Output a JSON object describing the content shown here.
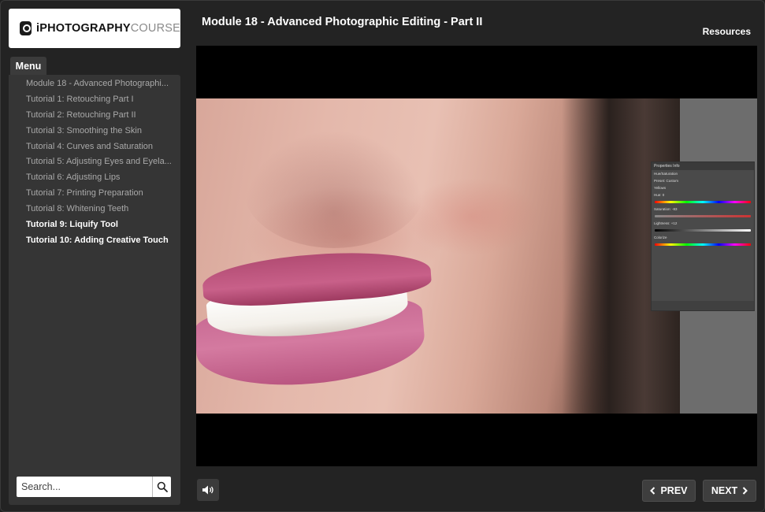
{
  "brand": {
    "bold": "iPHOTOGRAPHY",
    "light": "COURSE"
  },
  "menu": {
    "tab_label": "Menu",
    "items": [
      {
        "label": "Module 18 - Advanced Photographi...",
        "active": false
      },
      {
        "label": "Tutorial 1: Retouching Part I",
        "active": false
      },
      {
        "label": "Tutorial 2: Retouching Part II",
        "active": false
      },
      {
        "label": "Tutorial 3: Smoothing the Skin",
        "active": false
      },
      {
        "label": "Tutorial 4: Curves and Saturation",
        "active": false
      },
      {
        "label": "Tutorial 5: Adjusting Eyes and Eyela...",
        "active": false
      },
      {
        "label": "Tutorial 6: Adjusting Lips",
        "active": false
      },
      {
        "label": "Tutorial 7: Printing Preparation",
        "active": false
      },
      {
        "label": "Tutorial 8: Whitening Teeth",
        "active": false
      },
      {
        "label": "Tutorial 9: Liquify Tool",
        "active": true
      },
      {
        "label": "Tutorial 10: Adding Creative Touch",
        "active": true
      }
    ]
  },
  "search": {
    "placeholder": "Search..."
  },
  "header": {
    "title": "Module 18 - Advanced Photographic Editing - Part II",
    "resources_label": "Resources"
  },
  "video_panel": {
    "tabs": "Properties   Info",
    "adjustment": "Hue/Saturation",
    "preset_label": "Preset:",
    "preset_value": "Custom",
    "channel": "Yellows",
    "hue_label": "Hue:",
    "hue_value": "0",
    "saturation_label": "Saturation:",
    "saturation_value": "-83",
    "lightness_label": "Lightness:",
    "lightness_value": "+12",
    "colorize_label": "Colorize"
  },
  "controls": {
    "prev_label": "PREV",
    "next_label": "NEXT"
  },
  "icons": {
    "volume": "speaker-icon",
    "search": "magnifier-icon",
    "prev": "chevron-left-icon",
    "next": "chevron-right-icon"
  }
}
